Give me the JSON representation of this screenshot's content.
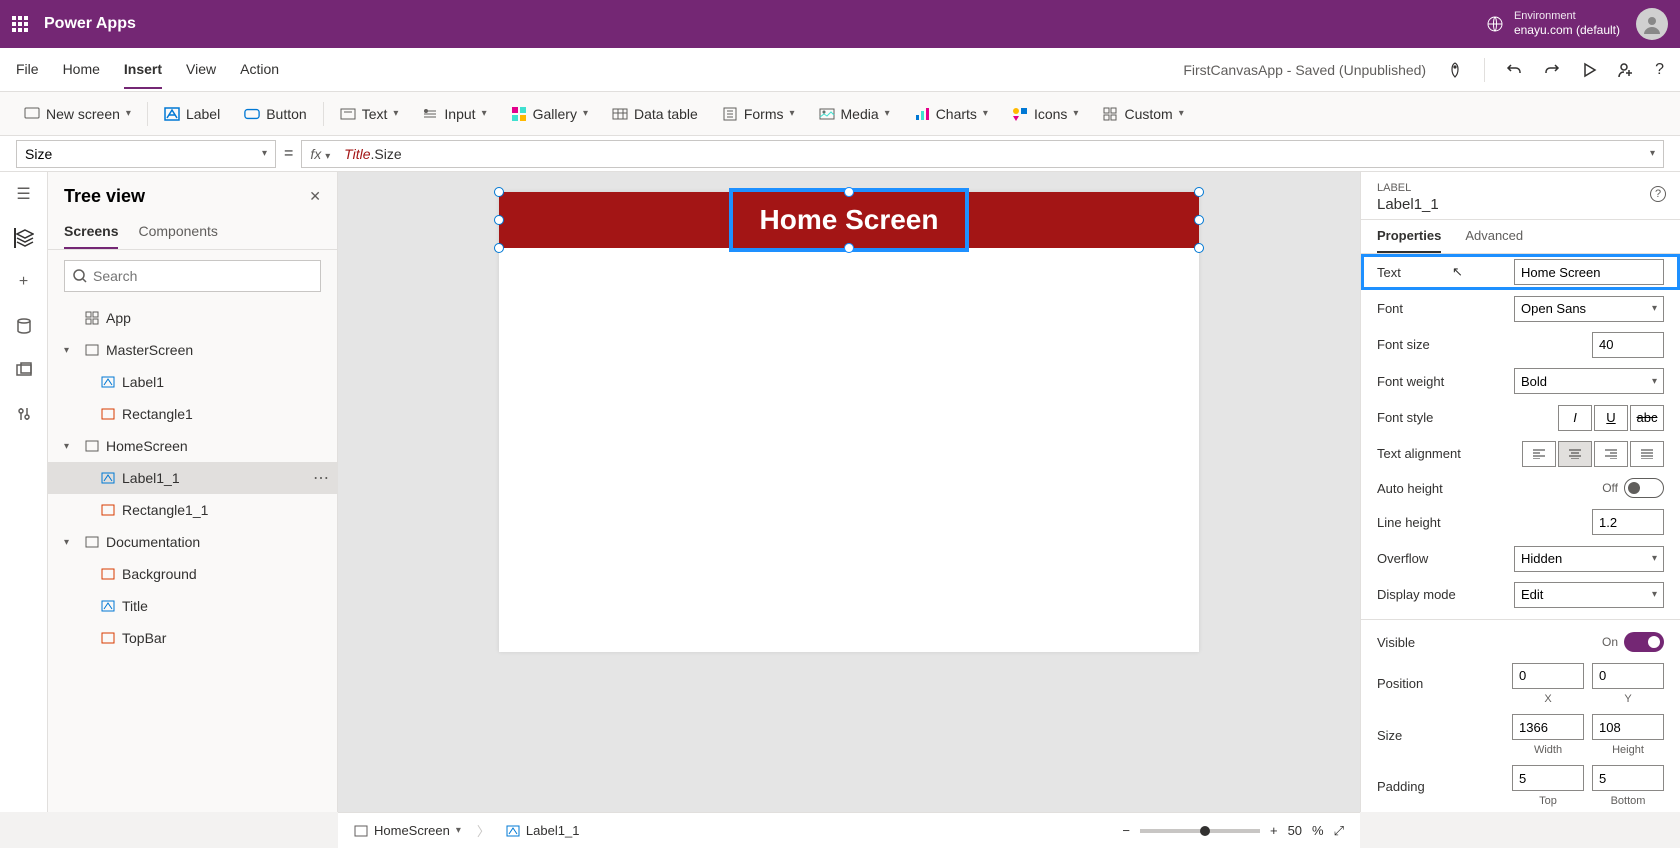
{
  "header": {
    "app_name": "Power Apps",
    "env_label": "Environment",
    "env_name": "enayu.com (default)"
  },
  "menubar": {
    "items": [
      "File",
      "Home",
      "Insert",
      "View",
      "Action"
    ],
    "active": "Insert",
    "app_status": "FirstCanvasApp - Saved (Unpublished)"
  },
  "ribbon": {
    "new_screen": "New screen",
    "label": "Label",
    "button": "Button",
    "text": "Text",
    "input": "Input",
    "gallery": "Gallery",
    "data_table": "Data table",
    "forms": "Forms",
    "media": "Media",
    "charts": "Charts",
    "icons": "Icons",
    "custom": "Custom"
  },
  "formula": {
    "property": "Size",
    "fx": "fx",
    "expr_obj": "Title",
    "expr_prop": ".Size"
  },
  "tree": {
    "title": "Tree view",
    "tabs": [
      "Screens",
      "Components"
    ],
    "active_tab": "Screens",
    "search_placeholder": "Search",
    "items": {
      "app": "App",
      "master": "MasterScreen",
      "label1": "Label1",
      "rect1": "Rectangle1",
      "home": "HomeScreen",
      "label1_1": "Label1_1",
      "rect1_1": "Rectangle1_1",
      "doc": "Documentation",
      "bg": "Background",
      "title": "Title",
      "topbar": "TopBar"
    }
  },
  "canvas": {
    "banner_text": "Home Screen"
  },
  "props": {
    "type": "LABEL",
    "name": "Label1_1",
    "tabs": [
      "Properties",
      "Advanced"
    ],
    "active_tab": "Properties",
    "text_label": "Text",
    "text_value": "Home Screen",
    "font_label": "Font",
    "font_value": "Open Sans",
    "fontsize_label": "Font size",
    "fontsize_value": "40",
    "fontweight_label": "Font weight",
    "fontweight_value": "Bold",
    "fontstyle_label": "Font style",
    "textalign_label": "Text alignment",
    "autoheight_label": "Auto height",
    "autoheight_value": "Off",
    "lineheight_label": "Line height",
    "lineheight_value": "1.2",
    "overflow_label": "Overflow",
    "overflow_value": "Hidden",
    "displaymode_label": "Display mode",
    "displaymode_value": "Edit",
    "visible_label": "Visible",
    "visible_value": "On",
    "position_label": "Position",
    "pos_x": "0",
    "pos_y": "0",
    "pos_x_lbl": "X",
    "pos_y_lbl": "Y",
    "size_label": "Size",
    "size_w": "1366",
    "size_h": "108",
    "size_w_lbl": "Width",
    "size_h_lbl": "Height",
    "padding_label": "Padding",
    "pad_t": "5",
    "pad_b": "5",
    "pad_t_lbl": "Top",
    "pad_b_lbl": "Bottom"
  },
  "bottom": {
    "screen": "HomeScreen",
    "element": "Label1_1",
    "zoom": "50",
    "pct": "%"
  }
}
